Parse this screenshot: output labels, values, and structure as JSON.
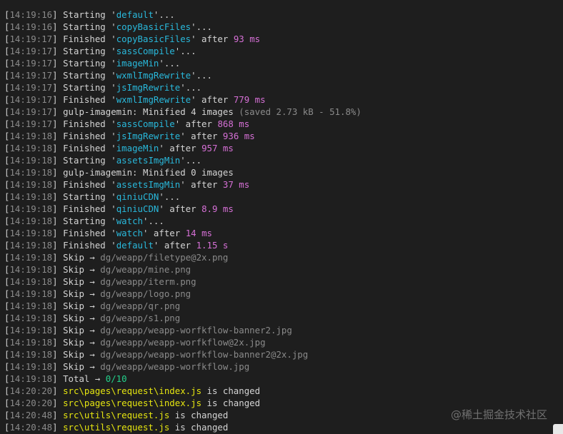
{
  "watermark": "@稀土掘金技术社区",
  "lines": [
    {
      "time": "14:19:16",
      "segs": [
        [
          "txt",
          "Starting "
        ],
        [
          "q",
          "'"
        ],
        [
          "task",
          "default"
        ],
        [
          "q",
          "'"
        ],
        [
          "txt",
          "..."
        ]
      ]
    },
    {
      "time": "14:19:16",
      "segs": [
        [
          "txt",
          "Starting "
        ],
        [
          "q",
          "'"
        ],
        [
          "task",
          "copyBasicFiles"
        ],
        [
          "q",
          "'"
        ],
        [
          "txt",
          "..."
        ]
      ]
    },
    {
      "time": "14:19:17",
      "segs": [
        [
          "txt",
          "Finished "
        ],
        [
          "q",
          "'"
        ],
        [
          "task",
          "copyBasicFiles"
        ],
        [
          "q",
          "'"
        ],
        [
          "txt",
          " after "
        ],
        [
          "num",
          "93 ms"
        ]
      ]
    },
    {
      "time": "14:19:17",
      "segs": [
        [
          "txt",
          "Starting "
        ],
        [
          "q",
          "'"
        ],
        [
          "task",
          "sassCompile"
        ],
        [
          "q",
          "'"
        ],
        [
          "txt",
          "..."
        ]
      ]
    },
    {
      "time": "14:19:17",
      "segs": [
        [
          "txt",
          "Starting "
        ],
        [
          "q",
          "'"
        ],
        [
          "task",
          "imageMin"
        ],
        [
          "q",
          "'"
        ],
        [
          "txt",
          "..."
        ]
      ]
    },
    {
      "time": "14:19:17",
      "segs": [
        [
          "txt",
          "Starting "
        ],
        [
          "q",
          "'"
        ],
        [
          "task",
          "wxmlImgRewrite"
        ],
        [
          "q",
          "'"
        ],
        [
          "txt",
          "..."
        ]
      ]
    },
    {
      "time": "14:19:17",
      "segs": [
        [
          "txt",
          "Starting "
        ],
        [
          "q",
          "'"
        ],
        [
          "task",
          "jsImgRewrite"
        ],
        [
          "q",
          "'"
        ],
        [
          "txt",
          "..."
        ]
      ]
    },
    {
      "time": "14:19:17",
      "segs": [
        [
          "txt",
          "Finished "
        ],
        [
          "q",
          "'"
        ],
        [
          "task",
          "wxmlImgRewrite"
        ],
        [
          "q",
          "'"
        ],
        [
          "txt",
          " after "
        ],
        [
          "num",
          "779 ms"
        ]
      ]
    },
    {
      "time": "14:19:17",
      "segs": [
        [
          "txt",
          "gulp-imagemin: Minified 4 images "
        ],
        [
          "dim",
          "(saved 2.73 kB - 51.8%)"
        ]
      ]
    },
    {
      "time": "14:19:17",
      "segs": [
        [
          "txt",
          "Finished "
        ],
        [
          "q",
          "'"
        ],
        [
          "task",
          "sassCompile"
        ],
        [
          "q",
          "'"
        ],
        [
          "txt",
          " after "
        ],
        [
          "num",
          "868 ms"
        ]
      ]
    },
    {
      "time": "14:19:18",
      "segs": [
        [
          "txt",
          "Finished "
        ],
        [
          "q",
          "'"
        ],
        [
          "task",
          "jsImgRewrite"
        ],
        [
          "q",
          "'"
        ],
        [
          "txt",
          " after "
        ],
        [
          "num",
          "936 ms"
        ]
      ]
    },
    {
      "time": "14:19:18",
      "segs": [
        [
          "txt",
          "Finished "
        ],
        [
          "q",
          "'"
        ],
        [
          "task",
          "imageMin"
        ],
        [
          "q",
          "'"
        ],
        [
          "txt",
          " after "
        ],
        [
          "num",
          "957 ms"
        ]
      ]
    },
    {
      "time": "14:19:18",
      "segs": [
        [
          "txt",
          "Starting "
        ],
        [
          "q",
          "'"
        ],
        [
          "task",
          "assetsImgMin"
        ],
        [
          "q",
          "'"
        ],
        [
          "txt",
          "..."
        ]
      ]
    },
    {
      "time": "14:19:18",
      "segs": [
        [
          "txt",
          "gulp-imagemin: Minified 0 images"
        ]
      ]
    },
    {
      "time": "14:19:18",
      "segs": [
        [
          "txt",
          "Finished "
        ],
        [
          "q",
          "'"
        ],
        [
          "task",
          "assetsImgMin"
        ],
        [
          "q",
          "'"
        ],
        [
          "txt",
          " after "
        ],
        [
          "num",
          "37 ms"
        ]
      ]
    },
    {
      "time": "14:19:18",
      "segs": [
        [
          "txt",
          "Starting "
        ],
        [
          "q",
          "'"
        ],
        [
          "task",
          "qiniuCDN"
        ],
        [
          "q",
          "'"
        ],
        [
          "txt",
          "..."
        ]
      ]
    },
    {
      "time": "14:19:18",
      "segs": [
        [
          "txt",
          "Finished "
        ],
        [
          "q",
          "'"
        ],
        [
          "task",
          "qiniuCDN"
        ],
        [
          "q",
          "'"
        ],
        [
          "txt",
          " after "
        ],
        [
          "num",
          "8.9 ms"
        ]
      ]
    },
    {
      "time": "14:19:18",
      "segs": [
        [
          "txt",
          "Starting "
        ],
        [
          "q",
          "'"
        ],
        [
          "task",
          "watch"
        ],
        [
          "q",
          "'"
        ],
        [
          "txt",
          "..."
        ]
      ]
    },
    {
      "time": "14:19:18",
      "segs": [
        [
          "txt",
          "Finished "
        ],
        [
          "q",
          "'"
        ],
        [
          "task",
          "watch"
        ],
        [
          "q",
          "'"
        ],
        [
          "txt",
          " after "
        ],
        [
          "num",
          "14 ms"
        ]
      ]
    },
    {
      "time": "14:19:18",
      "segs": [
        [
          "txt",
          "Finished "
        ],
        [
          "q",
          "'"
        ],
        [
          "task",
          "default"
        ],
        [
          "q",
          "'"
        ],
        [
          "txt",
          " after "
        ],
        [
          "num",
          "1.15 s"
        ]
      ]
    },
    {
      "time": "14:19:18",
      "segs": [
        [
          "txt",
          "Skip → "
        ],
        [
          "dim",
          "dg/weapp/filetype@2x.png"
        ]
      ]
    },
    {
      "time": "14:19:18",
      "segs": [
        [
          "txt",
          "Skip → "
        ],
        [
          "dim",
          "dg/weapp/mine.png"
        ]
      ]
    },
    {
      "time": "14:19:18",
      "segs": [
        [
          "txt",
          "Skip → "
        ],
        [
          "dim",
          "dg/weapp/iterm.png"
        ]
      ]
    },
    {
      "time": "14:19:18",
      "segs": [
        [
          "txt",
          "Skip → "
        ],
        [
          "dim",
          "dg/weapp/logo.png"
        ]
      ]
    },
    {
      "time": "14:19:18",
      "segs": [
        [
          "txt",
          "Skip → "
        ],
        [
          "dim",
          "dg/weapp/qr.png"
        ]
      ]
    },
    {
      "time": "14:19:18",
      "segs": [
        [
          "txt",
          "Skip → "
        ],
        [
          "dim",
          "dg/weapp/s1.png"
        ]
      ]
    },
    {
      "time": "14:19:18",
      "segs": [
        [
          "txt",
          "Skip → "
        ],
        [
          "dim",
          "dg/weapp/weapp-worfkflow-banner2.jpg"
        ]
      ]
    },
    {
      "time": "14:19:18",
      "segs": [
        [
          "txt",
          "Skip → "
        ],
        [
          "dim",
          "dg/weapp/weapp-worfkflow@2x.jpg"
        ]
      ]
    },
    {
      "time": "14:19:18",
      "segs": [
        [
          "txt",
          "Skip → "
        ],
        [
          "dim",
          "dg/weapp/weapp-worfkflow-banner2@2x.jpg"
        ]
      ]
    },
    {
      "time": "14:19:18",
      "segs": [
        [
          "txt",
          "Skip → "
        ],
        [
          "dim",
          "dg/weapp/weapp-worfkflow.jpg"
        ]
      ]
    },
    {
      "time": "14:19:18",
      "segs": [
        [
          "txt",
          "Total → "
        ],
        [
          "green",
          "0/10"
        ]
      ]
    },
    {
      "time": "14:20:20",
      "segs": [
        [
          "yellow",
          "src\\pages\\request\\index.js"
        ],
        [
          "txt",
          " is changed"
        ]
      ]
    },
    {
      "time": "14:20:20",
      "segs": [
        [
          "yellow",
          "src\\pages\\request\\index.js"
        ],
        [
          "txt",
          " is changed"
        ]
      ]
    },
    {
      "time": "14:20:48",
      "segs": [
        [
          "yellow",
          "src\\utils\\request.js"
        ],
        [
          "txt",
          " is changed"
        ]
      ]
    },
    {
      "time": "14:20:48",
      "segs": [
        [
          "yellow",
          "src\\utils\\request.js"
        ],
        [
          "txt",
          " is changed"
        ]
      ]
    }
  ]
}
